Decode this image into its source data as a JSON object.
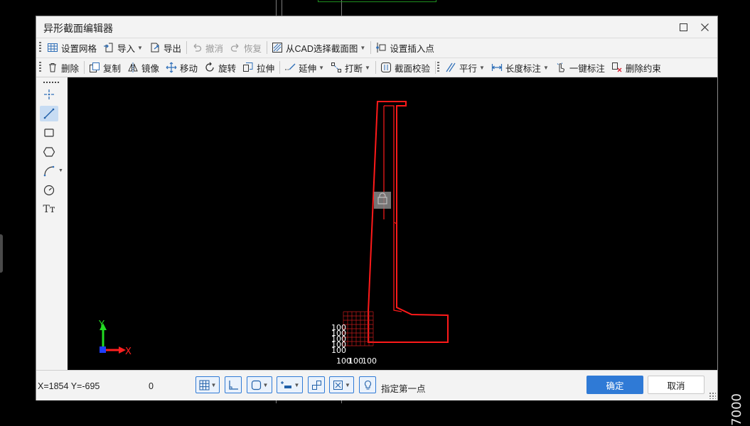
{
  "background": {
    "vertical_readout": "7000"
  },
  "dialog": {
    "title": "异形截面编辑器",
    "controls": {
      "maximize_icon": "maximize-icon",
      "close_icon": "close-icon"
    }
  },
  "toolbar1": {
    "grid": "设置网格",
    "import": "导入",
    "export": "导出",
    "undo": "撤消",
    "redo": "恢复",
    "from_cad": "从CAD选择截面图",
    "insert_point": "设置插入点"
  },
  "toolbar2": {
    "delete": "删除",
    "copy": "复制",
    "mirror": "镜像",
    "move": "移动",
    "rotate": "旋转",
    "stretch": "拉伸",
    "extend": "延伸",
    "break": "打断",
    "check": "截面校验",
    "parallel": "平行",
    "length_dim": "长度标注",
    "one_key_dim": "一键标注",
    "delete_constraint": "删除约束"
  },
  "left_tools": [
    {
      "name": "point-icon"
    },
    {
      "name": "line-icon",
      "active": true
    },
    {
      "name": "rectangle-icon"
    },
    {
      "name": "hexagon-icon"
    },
    {
      "name": "arc-icon"
    },
    {
      "name": "circle-icon"
    },
    {
      "name": "text-icon",
      "label": "Tт"
    }
  ],
  "canvas": {
    "axis_x": "X",
    "axis_y": "Y",
    "dim_label": "100",
    "colors": {
      "profile": "#ff1a1a",
      "axis_x": "#ff2020",
      "axis_y": "#22dd22",
      "origin": "#1f3fff"
    }
  },
  "status": {
    "coords": "X=1854 Y=-695",
    "value": "0",
    "hint": "指定第一点",
    "ok": "确定",
    "cancel": "取消"
  },
  "colors": {
    "accent": "#2f7ad6",
    "dialog_bg": "#f3f3f3",
    "canvas_bg": "#000000"
  }
}
